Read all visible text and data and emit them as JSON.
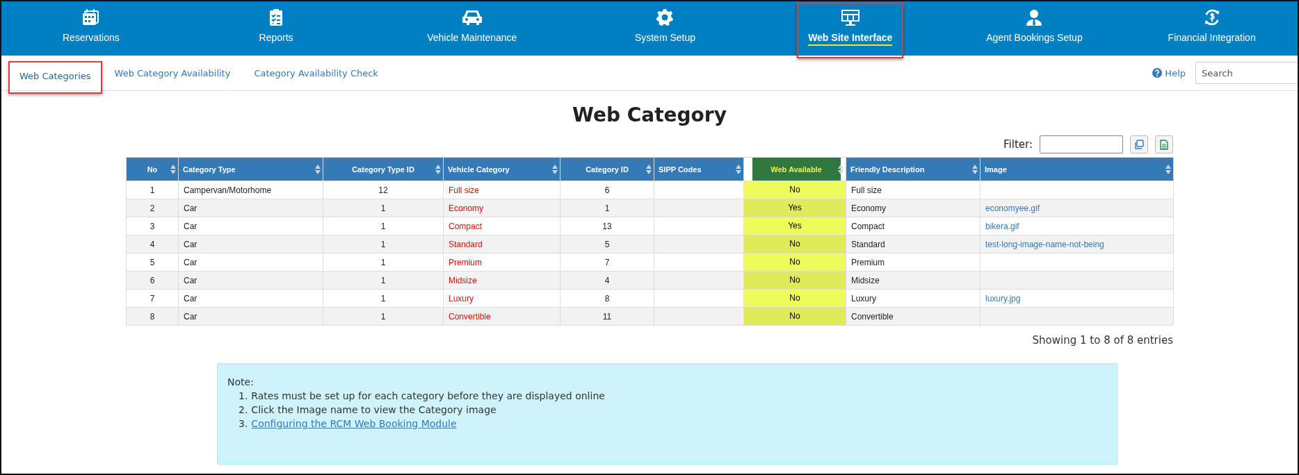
{
  "nav": [
    {
      "label": "Reservations",
      "selected": false,
      "highlighted": false
    },
    {
      "label": "Reports",
      "selected": false,
      "highlighted": false
    },
    {
      "label": "Vehicle Maintenance",
      "selected": false,
      "highlighted": false
    },
    {
      "label": "System Setup",
      "selected": false,
      "highlighted": false
    },
    {
      "label": "Web Site Interface",
      "selected": true,
      "highlighted": true
    },
    {
      "label": "Agent Bookings Setup",
      "selected": false,
      "highlighted": false
    },
    {
      "label": "Financial Integration",
      "selected": false,
      "highlighted": false
    }
  ],
  "tabs": [
    {
      "label": "Web Categories",
      "selected": true,
      "highlighted": true
    },
    {
      "label": "Web Category Availability",
      "selected": false,
      "highlighted": false
    },
    {
      "label": "Category Availability Check",
      "selected": false,
      "highlighted": false
    }
  ],
  "help": {
    "label": "Help"
  },
  "search": {
    "placeholder": "Search"
  },
  "title": "Web Category",
  "filter": {
    "label": "Filter:"
  },
  "table": {
    "columns": [
      {
        "label": "No",
        "kind": "number",
        "highlighted": false
      },
      {
        "label": "Category Type",
        "kind": "text",
        "highlighted": false
      },
      {
        "label": "Category Type ID",
        "kind": "number",
        "highlighted": false
      },
      {
        "label": "Vehicle Category",
        "kind": "text",
        "highlighted": false,
        "color": "#ff0000"
      },
      {
        "label": "Category ID",
        "kind": "number",
        "highlighted": false
      },
      {
        "label": "SIPP Codes",
        "kind": "text",
        "highlighted": false
      },
      {
        "label": "Web Available",
        "kind": "number",
        "highlighted": true
      },
      {
        "label": "Friendly Description",
        "kind": "text",
        "highlighted": false
      },
      {
        "label": "Image",
        "kind": "link",
        "highlighted": false
      }
    ],
    "rows": [
      [
        "1",
        "Campervan/Motorhome",
        "12",
        "Full size",
        "6",
        "",
        "No",
        "Full size",
        ""
      ],
      [
        "2",
        "Car",
        "1",
        "Economy",
        "1",
        "",
        "Yes",
        "Economy",
        "economyee.gif"
      ],
      [
        "3",
        "Car",
        "1",
        "Compact",
        "13",
        "",
        "Yes",
        "Compact",
        "bikera.gif"
      ],
      [
        "4",
        "Car",
        "1",
        "Standard",
        "5",
        "",
        "No",
        "Standard",
        "test-long-image-name-not-being"
      ],
      [
        "5",
        "Car",
        "1",
        "Premium",
        "7",
        "",
        "No",
        "Premium",
        ""
      ],
      [
        "6",
        "Car",
        "1",
        "Midsize",
        "4",
        "",
        "No",
        "Midsize",
        ""
      ],
      [
        "7",
        "Car",
        "1",
        "Luxury",
        "8",
        "",
        "No",
        "Luxury",
        "luxury.jpg"
      ],
      [
        "8",
        "Car",
        "1",
        "Convertible",
        "11",
        "",
        "No",
        "Convertible",
        ""
      ]
    ]
  },
  "info": "Showing 1 to 8 of 8 entries",
  "note": {
    "heading": "Note:",
    "items": [
      {
        "number": "1.",
        "text": "Rates must be set up for each category before they are displayed online",
        "kind": "text"
      },
      {
        "number": "2.",
        "text": "Click the Image name to view the Category image",
        "kind": "text"
      },
      {
        "number": "3.",
        "text": "Configuring the RCM Web Booking Module",
        "kind": "link"
      }
    ]
  }
}
